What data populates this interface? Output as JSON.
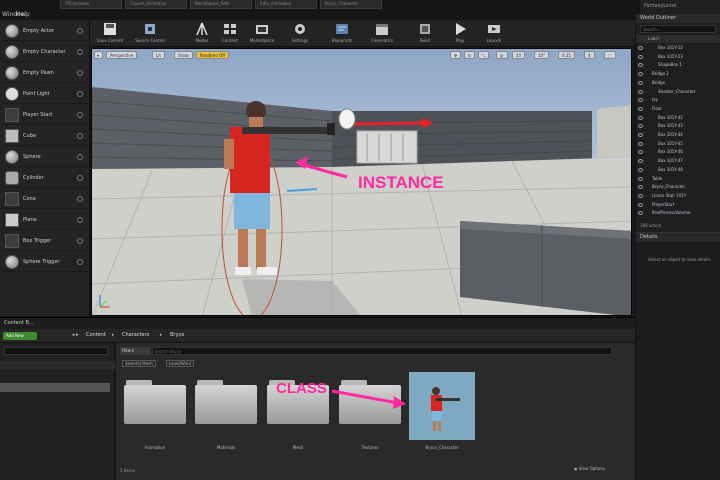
{
  "menu": {
    "items": [
      "Window",
      "Help"
    ]
  },
  "tabs": [
    "TPCharacter",
    "Crouch_Animation",
    "BlendSpace_Rifle",
    "Rifle_Animation",
    "Bryce_Character"
  ],
  "title_right": "FantasyLevel",
  "place_panel": {
    "items": [
      "Empty Actor",
      "Empty Character",
      "Empty Pawn",
      "Point Light",
      "Player Start",
      "Cube",
      "Sphere",
      "Cylinder",
      "Cone",
      "Plane",
      "Box Trigger",
      "Sphere Trigger"
    ]
  },
  "toolbar": {
    "buttons": [
      "Save Current",
      "Source Control",
      "Modes",
      "Content",
      "Marketplace",
      "Settings",
      "Blueprints",
      "Cinematics",
      "Build",
      "Play",
      "Launch"
    ]
  },
  "viewport": {
    "perspective": "Perspective",
    "lit": "Lit",
    "show": "Show",
    "realtime": "Realtime Off",
    "grid_value": "10",
    "angle_value": "10°",
    "scale_value": "0.25",
    "speed_value": "4"
  },
  "annotations": {
    "instance": "INSTANCE",
    "class": "CLASS",
    "color": "#ff2aa0"
  },
  "outliner": {
    "title": "World Outliner",
    "search_placeholder": "Search...",
    "column": "Label",
    "rows": [
      "Box 101Y-12",
      "Box 101Y-13",
      "ShapeBox 1",
      "Bridge 2",
      "Bridge",
      "Shooter_Character",
      "Ivy",
      "Floor",
      "Box 101Y-42",
      "Box 101Y-43",
      "Box 101Y-44",
      "Box 101Y-45",
      "Box 101Y-46",
      "Box 101Y-47",
      "Box 101Y-48",
      "Table",
      "Bryce_Character",
      "Linear Stair 101Y",
      "PlayerStart",
      "PostProcessVolume"
    ],
    "footer": "188 actors"
  },
  "details": {
    "title": "Details",
    "hint": "Select an object to view details."
  },
  "content_browser": {
    "tab": "Content B...",
    "add_new": "Add New",
    "path": [
      "Content",
      "Characters",
      "Bryce"
    ],
    "filters": "Filters",
    "search_placeholder": "Search Bryce",
    "filter_chips": [
      "Skeletal Mesh",
      "Level/Wind"
    ],
    "assets": [
      {
        "name": "Animation",
        "kind": "folder"
      },
      {
        "name": "Materials",
        "kind": "folder"
      },
      {
        "name": "Mesh",
        "kind": "folder"
      },
      {
        "name": "Textures",
        "kind": "folder"
      },
      {
        "name": "Bryce_Character",
        "kind": "blueprint"
      }
    ],
    "item_count": "5 items",
    "view_options": "View Options"
  }
}
